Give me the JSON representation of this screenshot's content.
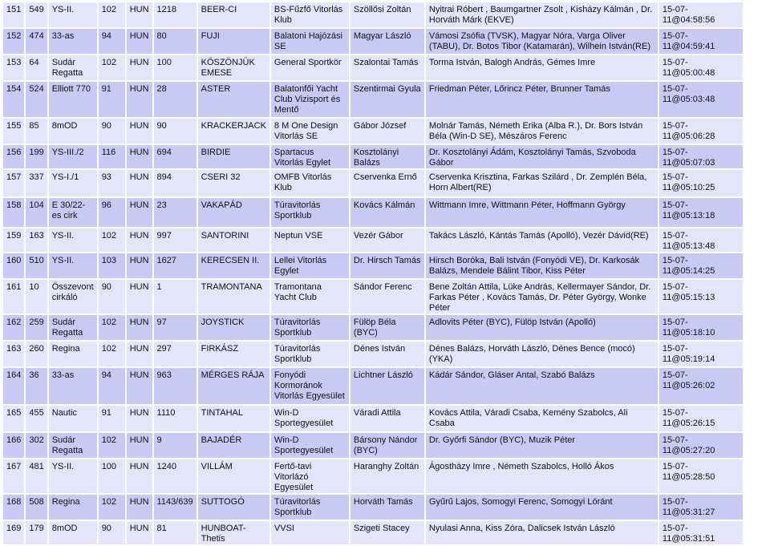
{
  "colors": {
    "row_light": "#e4e4fa",
    "row_dark": "#c9c9f6",
    "border": "#ffffff"
  },
  "rows": [
    [
      "151",
      "549",
      "YS-II.",
      "102",
      "HUN",
      "1218",
      "BEER-CI",
      "BS-Fűzfő Vitorlás Klub",
      "Szöllősi Zoltán",
      "Nyitrai Róbert , Baumgartner Zsolt , Kisházy Kálmán , Dr. Horváth Márk (EKVE)",
      "15-07-11@04:58:56"
    ],
    [
      "152",
      "474",
      "33-as",
      "94",
      "HUN",
      "80",
      "FUJI",
      "Balatoni Hajózási SE",
      "Magyar László",
      "Vámosi Zsófia (TVSK), Magyar Nóra, Varga Oliver (TABU), Dr. Botos Tibor (Katamarán), Wilhein István(RE)",
      "15-07-11@04:59:41"
    ],
    [
      "153",
      "64",
      "Sudár Regatta",
      "102",
      "HUN",
      "100",
      "KÖSZÖNJÜK EMESE",
      "General Sportkör",
      "Szalontai Tamás",
      "Torma István, Balogh András, Gémes Imre",
      "15-07-11@05:00:48"
    ],
    [
      "154",
      "524",
      "Elliott 770",
      "91",
      "HUN",
      "28",
      "ASTER",
      "Balatonfői Yacht Club Vizisport és Mentő",
      "Szentirmai Gyula",
      "Friedman Péter, Lőrincz Péter, Brunner Tamás",
      "15-07-11@05:03:48"
    ],
    [
      "155",
      "85",
      "8mOD",
      "90",
      "HUN",
      "90",
      "KRACKERJACK",
      "8 M One Design Vitorlás SE",
      "Gábor József",
      "Molnár Tamás, Németh Erika (Alba R.), Dr. Bors István Béla (Win-D SE), Mészáros Ferenc",
      "15-07-11@05:06:28"
    ],
    [
      "156",
      "199",
      "YS-III./2",
      "116",
      "HUN",
      "694",
      "BIRDIE",
      "Spartacus Vitorlás Egylet",
      "Kosztolányi Balázs",
      "Dr. Kosztolányi Ádám, Kosztolányi Tamás, Szvoboda Gábor",
      "15-07-11@05:07:03"
    ],
    [
      "157",
      "337",
      "YS-I./1",
      "93",
      "HUN",
      "894",
      "CSERI 32",
      "OMFB Vitorlás Klub",
      "Cservenka Ernő",
      "Cservenka Krisztina, Farkas Szilárd , Dr. Zemplén Béla, Horn Albert(RE)",
      "15-07-11@05:10:25"
    ],
    [
      "158",
      "104",
      "E 30/22-es cirk",
      "96",
      "HUN",
      "23",
      "VAKAPÁD",
      "Túravitorlás Sportklub",
      "Kovács Kálmán",
      "Wittmann Imre, Wittmann Péter, Hoffmann György",
      "15-07-11@05:13:18"
    ],
    [
      "159",
      "163",
      "YS-II.",
      "102",
      "HUN",
      "997",
      "SANTORINI",
      "Neptun VSE",
      "Vezér Gábor",
      "Takács László, Kántás Tamás (Apolló), Vezér Dávid(RE)",
      "15-07-11@05:13:48"
    ],
    [
      "160",
      "510",
      "YS-II.",
      "103",
      "HUN",
      "1627",
      "KERECSEN II.",
      "Lellei Vitorlás Egylet",
      "Dr. Hirsch Tamás",
      "Hirsch Boróka, Bali István (Fonyódi VE), Dr. Karkosák Balázs, Mendele Bálint Tibor, Kiss Péter",
      "15-07-11@05:14:25"
    ],
    [
      "161",
      "10",
      "Összevont cirkáló",
      "90",
      "HUN",
      "1",
      "TRAMONTANA",
      "Tramontana Yacht Club",
      "Sándor Ferenc",
      "Bene Zoltán Attila, Lüke András, Kellermayer Sándor, Dr. Farkas Péter , Kovács Tamás, Dr. Péter György, Wonke Péter",
      "15-07-11@05:15:13"
    ],
    [
      "162",
      "259",
      "Sudár Regatta",
      "102",
      "HUN",
      "97",
      "JOYSTICK",
      "Túravitorlás Sportklub",
      "Fülöp Béla (BYC)",
      "Adlovits Péter (BYC), Fülöp István (Apolló)",
      "15-07-11@05:18:10"
    ],
    [
      "163",
      "260",
      "Regina",
      "102",
      "HUN",
      "297",
      "FIRKÁSZ",
      "Túravitorlás Sportklub",
      "Dénes István",
      "Dénes Balázs, Horváth László, Dénes Bence (mocó) (YKA)",
      "15-07-11@05:19:14"
    ],
    [
      "164",
      "36",
      "33-as",
      "94",
      "HUN",
      "963",
      "MÉRGES RÁJA",
      "Fonyódi Kormoránok Vitorlás Egyesület",
      "Lichtner László",
      "Kádár Sándor, Gláser Antal, Szabó Balázs",
      "15-07-11@05:26:02"
    ],
    [
      "165",
      "455",
      "Nautic",
      "91",
      "HUN",
      "1110",
      "TINTAHAL",
      "Win-D Sportegyesület",
      "Váradi Attila",
      "Kovács Attila, Váradi Csaba, Kemény Szabolcs, Ali Csaba",
      "15-07-11@05:26:15"
    ],
    [
      "166",
      "302",
      "Sudár Regatta",
      "102",
      "HUN",
      "9",
      "BAJADÉR",
      "Win-D Sportegyesület",
      "Bársony Nándor (BYC)",
      "Dr. Győrfi Sándor (BYC), Muzik Péter",
      "15-07-11@05:27:20"
    ],
    [
      "167",
      "481",
      "YS-II.",
      "100",
      "HUN",
      "1240",
      "VILLÁM",
      "Fertő-tavi Vitorlázó Egyesület",
      "Haranghy Zoltán",
      "Ágostházy Imre , Németh Szabolcs, Holló Ákos",
      "15-07-11@05:28:50"
    ],
    [
      "168",
      "508",
      "Regina",
      "102",
      "HUN",
      "1143/639",
      "SUTTOGÓ",
      "Túravitorlás Sportklub",
      "Horváth Tamás",
      "Gyűrű Lajos, Somogyi Ferenc, Somogyi Lóránt",
      "15-07-11@05:31:27"
    ],
    [
      "169",
      "179",
      "8mOD",
      "90",
      "HUN",
      "81",
      "HUNBOAT-Thetis",
      "VVSI",
      "Szigeti Stacey",
      "Nyulasi Anna, Kiss Zóra, Dalicsek István László",
      "15-07-11@05:31:51"
    ]
  ]
}
